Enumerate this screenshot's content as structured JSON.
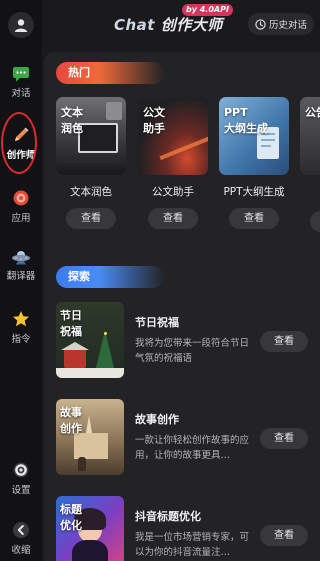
{
  "header": {
    "app_name_prefix": "Chat",
    "app_name_suffix": "创作大师",
    "version": "by 4.0API",
    "history_label": "历史对话"
  },
  "sidebar": {
    "items": [
      {
        "label": "对话",
        "icon": "chat-bubble-icon"
      },
      {
        "label": "创作师",
        "icon": "pencil-icon"
      },
      {
        "label": "应用",
        "icon": "app-icon"
      },
      {
        "label": "翻译器",
        "icon": "ufo-icon"
      },
      {
        "label": "指令",
        "icon": "star-icon"
      },
      {
        "label": "设置",
        "icon": "gear-icon"
      },
      {
        "label": "收缩",
        "icon": "collapse-icon"
      }
    ]
  },
  "hot": {
    "label": "热门",
    "cards": [
      {
        "overlay1": "文本",
        "overlay2": "润色",
        "title": "文本润色",
        "view": "查看"
      },
      {
        "overlay1": "公文",
        "overlay2": "助手",
        "title": "公文助手",
        "view": "查看"
      },
      {
        "overlay1": "PPT",
        "overlay2": "大纲生成",
        "title": "PPT大纲生成",
        "view": "查看"
      },
      {
        "overlay1": "公告",
        "overlay2": "",
        "title": "",
        "view": ""
      }
    ]
  },
  "explore": {
    "label": "探索",
    "items": [
      {
        "overlay1": "节日",
        "overlay2": "祝福",
        "title": "节日祝福",
        "desc": "我将为您带来一段符合节日气氛的祝福语",
        "view": "查看"
      },
      {
        "overlay1": "故事",
        "overlay2": "创作",
        "title": "故事创作",
        "desc": "一款让你轻松创作故事的应用，让你的故事更具…",
        "view": "查看"
      },
      {
        "overlay1": "标题",
        "overlay2": "优化",
        "title": "抖音标题优化",
        "desc": "我是一位市场营销专家，可以为你的抖音流量注…",
        "view": "查看"
      }
    ]
  },
  "colors": {
    "accent_red": "#e6473e",
    "accent_blue": "#3a7cf0",
    "highlight_ring": "#e0282f",
    "version_badge": "#d9325b"
  }
}
